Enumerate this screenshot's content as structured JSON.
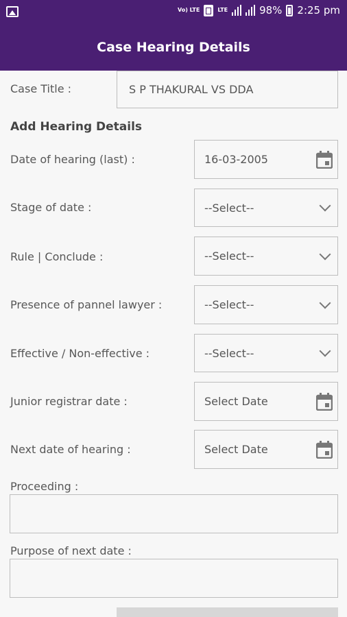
{
  "statusbar": {
    "volte_label": "Vo) LTE",
    "lte_label": "LTE",
    "battery": "98%",
    "time": "2:25 pm"
  },
  "appbar": {
    "title": "Case Hearing Details"
  },
  "case_title": {
    "label": "Case Title :",
    "value": "S P THAKURAL VS DDA"
  },
  "section_title": "Add Hearing Details",
  "fields": {
    "date_last": {
      "label": "Date of hearing (last) :",
      "value": "16-03-2005"
    },
    "stage": {
      "label": "Stage of date :",
      "value": "--Select--"
    },
    "rule": {
      "label": "Rule | Conclude :",
      "value": "--Select--"
    },
    "presence": {
      "label": "Presence of pannel lawyer :",
      "value": "--Select--"
    },
    "effective": {
      "label": "Effective / Non-effective :",
      "value": "--Select--"
    },
    "junior": {
      "label": "Junior registrar date :",
      "value": "Select Date"
    },
    "next": {
      "label": "Next date of hearing :",
      "value": "Select Date"
    },
    "proceeding": {
      "label": "Proceeding :",
      "value": ""
    },
    "purpose": {
      "label": "Purpose of next date :",
      "value": ""
    }
  },
  "icons": {
    "calendar": "calendar-icon",
    "dropdown": "chevron-down-icon",
    "gallery": "gallery-icon"
  },
  "colors": {
    "primary": "#4a1f73",
    "background": "#f7f7f7",
    "border": "#bdbdbd"
  }
}
